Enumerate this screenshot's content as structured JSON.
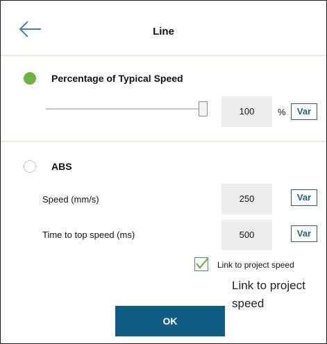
{
  "header": {
    "title": "Line",
    "back_icon": "arrow-left-icon"
  },
  "percentage_section": {
    "label": "Percentage of Typical Speed",
    "selected": true,
    "slider_fraction": 1.0,
    "value": "100",
    "unit": "%",
    "var_label": "Var"
  },
  "abs_section": {
    "label": "ABS",
    "selected": false,
    "speed_label": "Speed (mm/s)",
    "speed_value": "250",
    "speed_var_label": "Var",
    "time_label": "Time to top speed (ms)",
    "time_value": "500",
    "time_var_label": "Var"
  },
  "link": {
    "checked": true,
    "label": "Link to project speed",
    "tooltip": "Link to project speed"
  },
  "footer": {
    "ok_label": "OK"
  },
  "colors": {
    "radio_selected": "#6cb33f",
    "accent": "#1f5f8a",
    "ok_button": "#0f5d82",
    "divider": "#e8ecd2"
  }
}
